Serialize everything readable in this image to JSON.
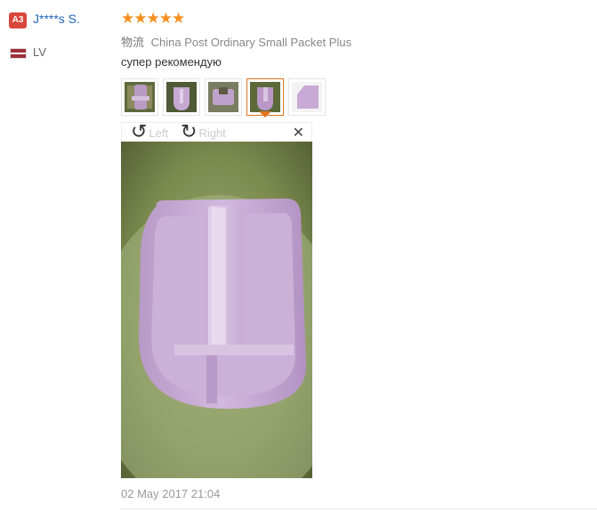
{
  "buyer": {
    "level": "A3",
    "name": "J****s S.",
    "country": "LV",
    "flag_colors": [
      "#9e3039",
      "#ffffff"
    ]
  },
  "review": {
    "rating_stars": 5,
    "stars_text": "★★★★★",
    "star_color": "#f78e1e",
    "logistics_label": "物流",
    "logistics": "China Post Ordinary Small Packet Plus",
    "feedback": "супер рекомендую",
    "thumbnails_count": 5,
    "active_thumbnail": 4,
    "viewer": {
      "rotate_left_label": "Left",
      "rotate_right_label": "Right",
      "close_glyph": "✕",
      "rotate_left_icon": "↺",
      "rotate_right_icon": "↻"
    },
    "date": "02 May 2017 21:04"
  },
  "colors": {
    "name": "#2266bb",
    "badge": "#d9463a",
    "accent": "#e0751f",
    "product": "#c9a5d6"
  }
}
